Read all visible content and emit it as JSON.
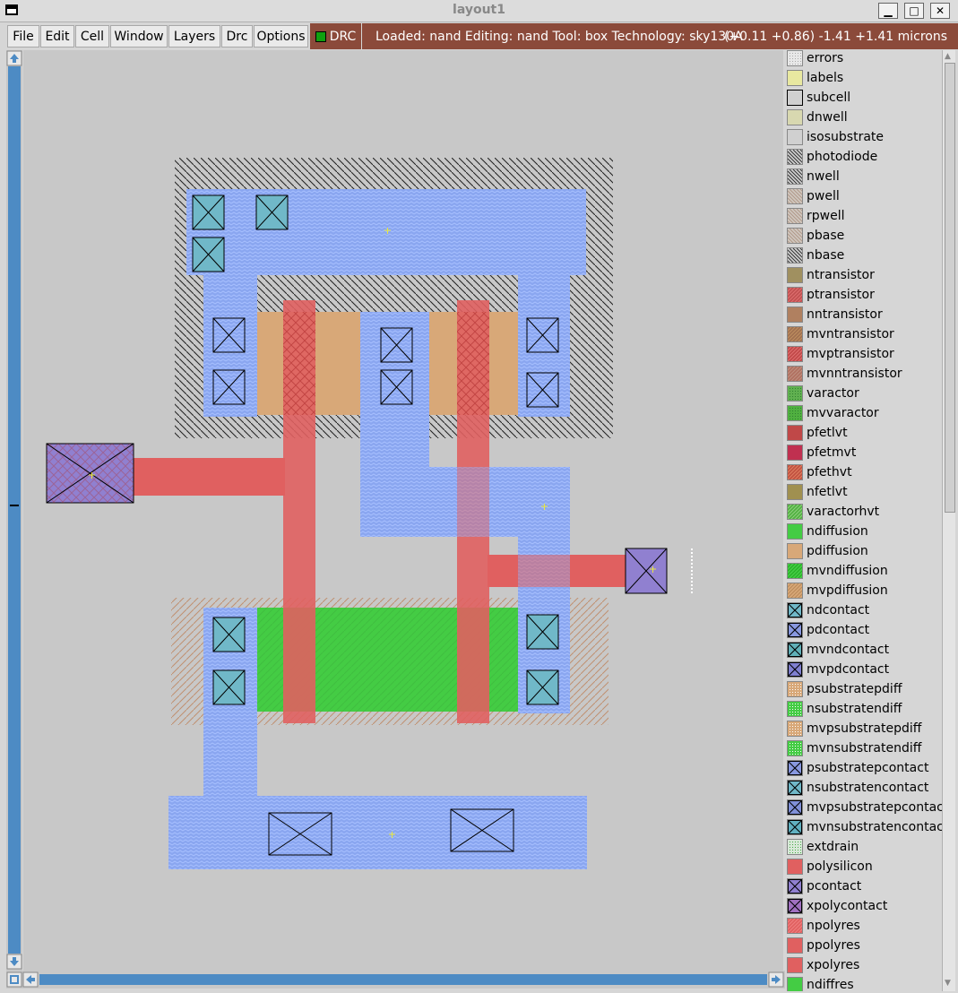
{
  "window": {
    "title": "layout1",
    "minimize_glyph": "▁",
    "maximize_glyph": "□",
    "close_glyph": "✕"
  },
  "menu": [
    {
      "label": "File",
      "id": "file"
    },
    {
      "label": "Edit",
      "id": "edit"
    },
    {
      "label": "Cell",
      "id": "cell"
    },
    {
      "label": "Window",
      "id": "window"
    },
    {
      "label": "Layers",
      "id": "layers"
    },
    {
      "label": "Drc",
      "id": "drc"
    },
    {
      "label": "Options",
      "id": "options"
    }
  ],
  "drc_button": {
    "label": "DRC"
  },
  "status": {
    "info": "Loaded: nand Editing: nand Tool: box  Technology: sky130A",
    "coords": "(+0.11 +0.86) -1.41 +1.41 microns"
  },
  "colors": {
    "nwell_hatch": "#1e1e1e",
    "metal1": "#8aa6f0",
    "polysilicon": "#e06060",
    "pdiffusion": "#d8a878",
    "ndiffusion": "#44cc44",
    "ndcontact": "#70b8c8",
    "pcontact": "#9080d0",
    "status_bg": "#8b4a3a"
  },
  "layers": [
    {
      "name": "errors",
      "fill": "#e8e8e8",
      "pattern": "dots",
      "pc": "#aaaaaa"
    },
    {
      "name": "labels",
      "fill": "#e8e8a0",
      "pattern": "none"
    },
    {
      "name": "subcell",
      "fill": "#d0d0d0",
      "pattern": "none",
      "border": "#000"
    },
    {
      "name": "dnwell",
      "fill": "#d8d8b0",
      "pattern": "none"
    },
    {
      "name": "isosubstrate",
      "fill": "#d0d0d0",
      "pattern": "none"
    },
    {
      "name": "photodiode",
      "fill": "#d0d0d0",
      "pattern": "hatch",
      "pc": "#333"
    },
    {
      "name": "nwell",
      "fill": "#d0d0d0",
      "pattern": "hatch",
      "pc": "#333"
    },
    {
      "name": "pwell",
      "fill": "#d0c8c0",
      "pattern": "hatch",
      "pc": "#b09888"
    },
    {
      "name": "rpwell",
      "fill": "#d0c8c0",
      "pattern": "hatch",
      "pc": "#b09888"
    },
    {
      "name": "pbase",
      "fill": "#d0c8c0",
      "pattern": "hatch",
      "pc": "#b09888"
    },
    {
      "name": "nbase",
      "fill": "#d0d0d0",
      "pattern": "hatch",
      "pc": "#333"
    },
    {
      "name": "ntransistor",
      "fill": "#a09060",
      "pattern": "none"
    },
    {
      "name": "ptransistor",
      "fill": "#c05050",
      "pattern": "hatch2",
      "pc": "#e07070"
    },
    {
      "name": "nntransistor",
      "fill": "#b08060",
      "pattern": "none"
    },
    {
      "name": "mvntransistor",
      "fill": "#a07050",
      "pattern": "hatch2",
      "pc": "#c09060"
    },
    {
      "name": "mvptransistor",
      "fill": "#c04848",
      "pattern": "hatch2",
      "pc": "#e07070"
    },
    {
      "name": "mvnntransistor",
      "fill": "#b07060",
      "pattern": "hatch2",
      "pc": "#c09080"
    },
    {
      "name": "varactor",
      "fill": "#60b050",
      "pattern": "dots",
      "pc": "#308030"
    },
    {
      "name": "mvvaractor",
      "fill": "#50b040",
      "pattern": "dots",
      "pc": "#308030"
    },
    {
      "name": "pfetlvt",
      "fill": "#c04848",
      "pattern": "none"
    },
    {
      "name": "pfetmvt",
      "fill": "#c03050",
      "pattern": "none"
    },
    {
      "name": "pfethvt",
      "fill": "#c05040",
      "pattern": "hatch2",
      "pc": "#e08060"
    },
    {
      "name": "nfetlvt",
      "fill": "#a09050",
      "pattern": "none"
    },
    {
      "name": "varactorhvt",
      "fill": "#50b040",
      "pattern": "hatch2",
      "pc": "#90d080"
    },
    {
      "name": "ndiffusion",
      "fill": "#44cc44",
      "pattern": "none"
    },
    {
      "name": "pdiffusion",
      "fill": "#d8a878",
      "pattern": "none"
    },
    {
      "name": "mvndiffusion",
      "fill": "#44cc44",
      "pattern": "hatch2",
      "pc": "#22aa22"
    },
    {
      "name": "mvpdiffusion",
      "fill": "#d8a878",
      "pattern": "hatch2",
      "pc": "#b88858"
    },
    {
      "name": "ndcontact",
      "fill": "#70b8c8",
      "pattern": "cross",
      "pc": "#000"
    },
    {
      "name": "pdcontact",
      "fill": "#8898e0",
      "pattern": "cross",
      "pc": "#000"
    },
    {
      "name": "mvndcontact",
      "fill": "#60b0b8",
      "pattern": "cross",
      "pc": "#000"
    },
    {
      "name": "mvpdcontact",
      "fill": "#8080d0",
      "pattern": "cross",
      "pc": "#000"
    },
    {
      "name": "psubstratepdiff",
      "fill": "#d8a878",
      "pattern": "dots",
      "pc": "#fff"
    },
    {
      "name": "nsubstratendiff",
      "fill": "#44cc44",
      "pattern": "dots",
      "pc": "#fff"
    },
    {
      "name": "mvpsubstratepdiff",
      "fill": "#d8a878",
      "pattern": "dots",
      "pc": "#fff"
    },
    {
      "name": "mvnsubstratendiff",
      "fill": "#44cc44",
      "pattern": "dots",
      "pc": "#fff"
    },
    {
      "name": "psubstratepcontact",
      "fill": "#8898e0",
      "pattern": "cross",
      "pc": "#000"
    },
    {
      "name": "nsubstratencontact",
      "fill": "#70b8c8",
      "pattern": "cross",
      "pc": "#000"
    },
    {
      "name": "mvpsubstratepcontact",
      "fill": "#8090d8",
      "pattern": "cross",
      "pc": "#000"
    },
    {
      "name": "mvnsubstratencontact",
      "fill": "#60b0c0",
      "pattern": "cross",
      "pc": "#000"
    },
    {
      "name": "extdrain",
      "fill": "#d8e8d8",
      "pattern": "dots",
      "pc": "#44aa44"
    },
    {
      "name": "polysilicon",
      "fill": "#e06060",
      "pattern": "none"
    },
    {
      "name": "pcontact",
      "fill": "#9080d0",
      "pattern": "cross",
      "pc": "#000"
    },
    {
      "name": "xpolycontact",
      "fill": "#a070c0",
      "pattern": "cross",
      "pc": "#000"
    },
    {
      "name": "npolyres",
      "fill": "#e06060",
      "pattern": "hatch2",
      "pc": "#f08080"
    },
    {
      "name": "ppolyres",
      "fill": "#e06060",
      "pattern": "none"
    },
    {
      "name": "xpolyres",
      "fill": "#e06060",
      "pattern": "none"
    },
    {
      "name": "ndiffres",
      "fill": "#44cc44",
      "pattern": "none"
    }
  ]
}
